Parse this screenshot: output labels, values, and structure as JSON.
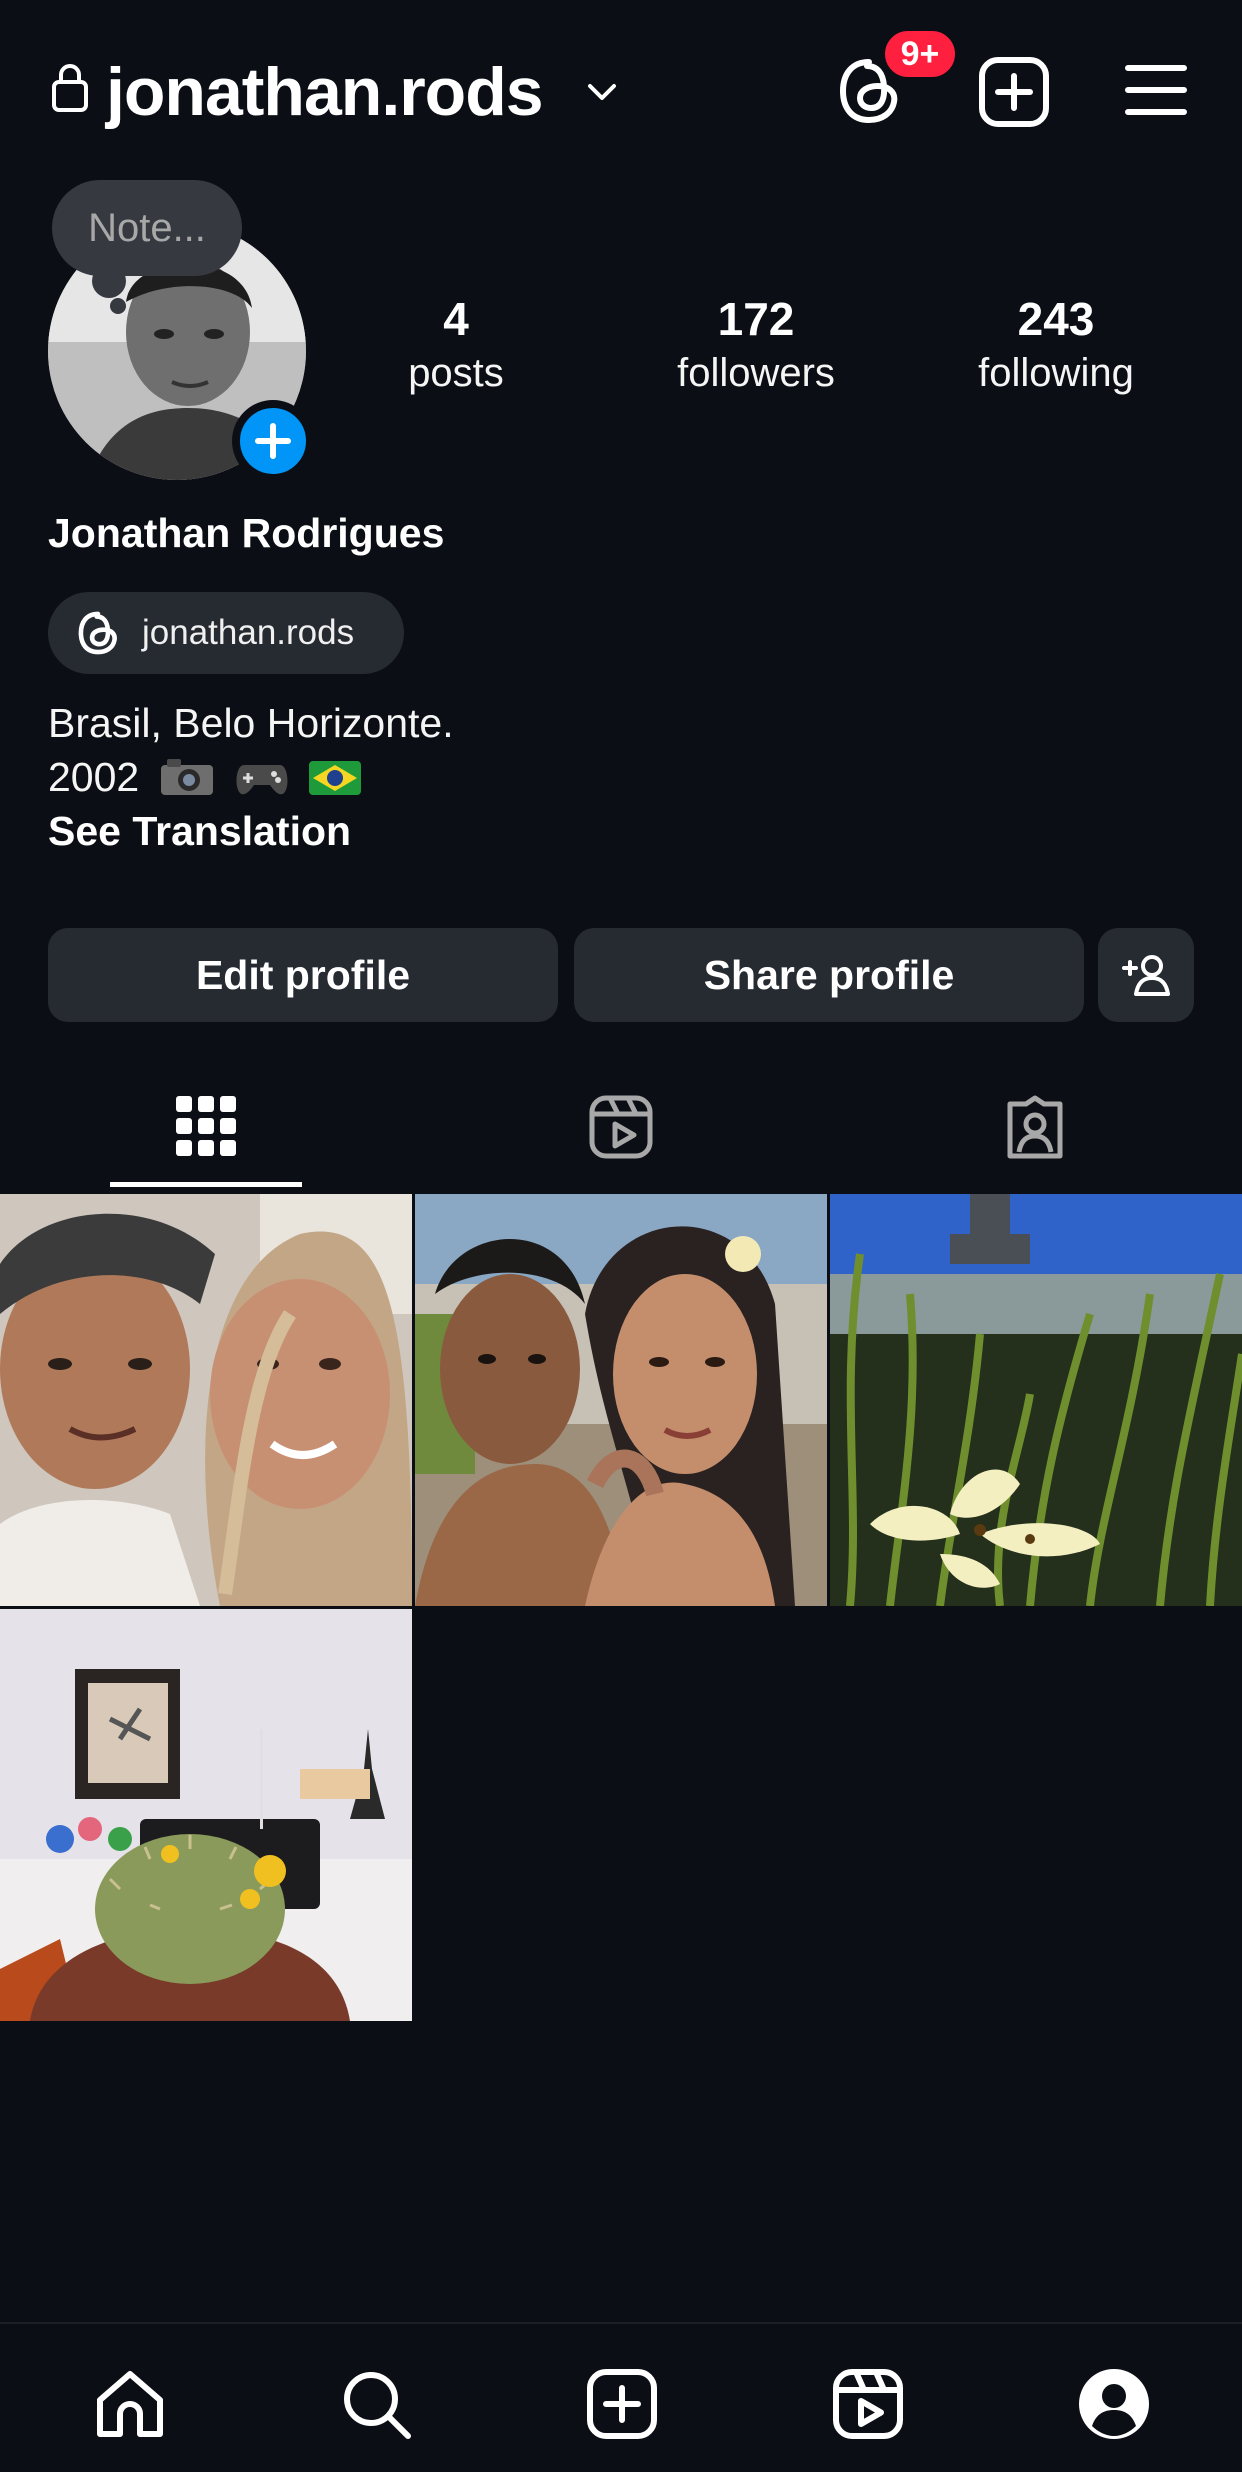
{
  "header": {
    "username": "jonathan.rods",
    "threads_badge": "9+"
  },
  "profile": {
    "note_placeholder": "Note...",
    "display_name": "Jonathan Rodrigues",
    "threads_handle": "jonathan.rods",
    "bio_line1": "Brasil, Belo Horizonte.",
    "bio_line2": "2002",
    "bio_emojis": [
      "camera-icon",
      "game-controller-icon",
      "brazil-flag-icon"
    ],
    "see_translation": "See Translation",
    "stats": [
      {
        "count": "4",
        "label": "posts"
      },
      {
        "count": "172",
        "label": "followers"
      },
      {
        "count": "243",
        "label": "following"
      }
    ]
  },
  "actions": {
    "edit_label": "Edit profile",
    "share_label": "Share profile"
  },
  "tabs": [
    {
      "name": "posts-grid",
      "icon": "grid-icon",
      "active": true
    },
    {
      "name": "reels",
      "icon": "reels-icon",
      "active": false
    },
    {
      "name": "tagged",
      "icon": "tagged-icon",
      "active": false
    }
  ],
  "posts": [
    {
      "icon": "selfie-photo"
    },
    {
      "icon": "couple-photo"
    },
    {
      "icon": "flower-photo"
    },
    {
      "icon": "cactus-desk-photo"
    }
  ],
  "bottom_nav": [
    "home-icon",
    "search-icon",
    "create-icon",
    "reels-icon",
    "profile-icon"
  ],
  "colors": {
    "background": "#0b0e14",
    "button": "#262a31",
    "accent_blue": "#0095f6",
    "badge_red": "#ff1f3e"
  }
}
